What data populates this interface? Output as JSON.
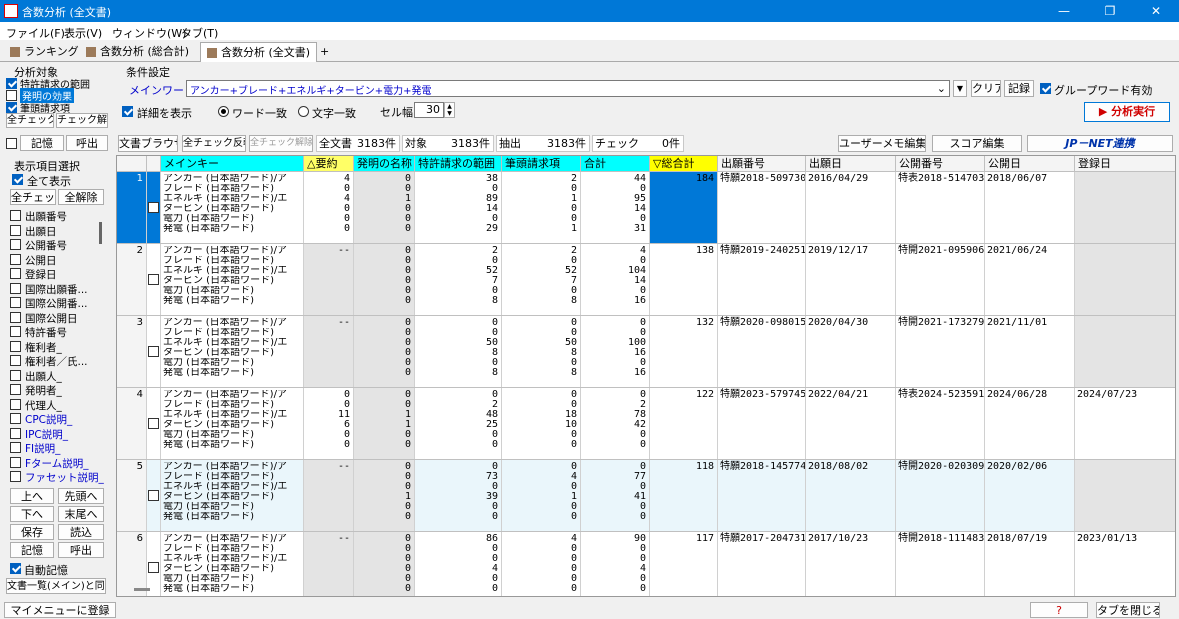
{
  "window": {
    "title": "含数分析 (全文書)",
    "min": "—",
    "max": "❐",
    "close": "✕"
  },
  "menu": [
    "ファイル(F)",
    "表示(V)",
    "ウィンドウ(W)",
    "タブ(T)"
  ],
  "tabs": [
    "ランキング",
    "含数分析 (総合計)",
    "含数分析 (全文書)",
    "+"
  ],
  "left": {
    "group_title": "分析対象",
    "targets": [
      {
        "label": "特許請求の範囲",
        "checked": true
      },
      {
        "label": "発明の効果",
        "checked": false
      },
      {
        "label": "筆頭請求項",
        "checked": true
      }
    ],
    "all_check": "全チェック",
    "check_clear": "チェック解除",
    "memory": "記憶",
    "recall": "呼出",
    "display_title": "表示項目選択",
    "show_all": "全て表示",
    "all_check2": "全チェック",
    "all_clear": "全解除",
    "items": [
      "出願番号",
      "出願日",
      "公開番号",
      "公開日",
      "登録日",
      "国際出願番...",
      "国際公開番...",
      "国際公開日",
      "特許番号",
      "権利者_",
      "権利者／氏...",
      "出願人_",
      "発明者_",
      "代理人_",
      "CPC説明_",
      "IPC説明_",
      "FI説明_",
      "Fターム説明_",
      "ファセット説明_"
    ],
    "up": "上へ",
    "top": "先頭へ",
    "down": "下へ",
    "bottom": "末尾へ",
    "save": "保存",
    "load": "読込",
    "memory2": "記憶",
    "recall2": "呼出",
    "auto_memory": "自動記憶",
    "sync": "文書一覧(メイン)と同期"
  },
  "cond": {
    "title": "条件設定",
    "mainword_label": "メインワード",
    "mainword": "アンカー+ブレード+エネルギ+タービン+電力+発電",
    "clear": "クリア",
    "record": "記録",
    "group_word": "グループワード有効",
    "detail": "詳細を表示",
    "word_match": "ワード一致",
    "char_match": "文字一致",
    "cell_width_label": "セル幅",
    "cell_width": "30",
    "run": "▶ 分析実行"
  },
  "toolbar": {
    "doc_browser": "文書ブラウザ",
    "check_invert": "全チェック反転",
    "check_clear": "全チェック解除",
    "all_docs_label": "全文書",
    "all_docs": "3183件",
    "target_label": "対象",
    "target": "3183件",
    "extract_label": "抽出",
    "extract": "3183件",
    "check_label": "チェック",
    "check": "0件",
    "memo_edit": "ユーザーメモ編集",
    "score_edit": "スコア編集",
    "jpnet": "JP－NET連携"
  },
  "columns": [
    "メインキー",
    "△要約",
    "発明の名称",
    "特許請求の範囲",
    "筆頭請求項",
    "合計",
    "▽総合計",
    "出願番号",
    "出願日",
    "公開番号",
    "公開日",
    "登録日"
  ],
  "keys": [
    "アンカー (日本語ワード)/ア",
    "ブレード (日本語ワード)",
    "エネルギ (日本語ワード)/エ",
    "タービン (日本語ワード)",
    "電力 (日本語ワード)",
    "発電 (日本語ワード)"
  ],
  "rows": [
    {
      "no": "1",
      "youyaku": [
        "4",
        "0",
        "4",
        "0",
        "0",
        "0"
      ],
      "meisho": [
        "0",
        "0",
        "1",
        "0",
        "0",
        "0"
      ],
      "seikyu": [
        "38",
        "0",
        "89",
        "14",
        "0",
        "29"
      ],
      "hitto": [
        "2",
        "0",
        "1",
        "0",
        "0",
        "1"
      ],
      "goukei": [
        "44",
        "0",
        "95",
        "14",
        "0",
        "31"
      ],
      "sougoukei": "184",
      "shutsugan": "特願2018-509730",
      "shutsugan_bi": "2016/04/29",
      "kokai": "特表2018-514703",
      "kokai_bi": "2018/06/07",
      "toroku": ""
    },
    {
      "no": "2",
      "youyaku": [
        "--",
        "",
        "",
        "",
        "",
        ""
      ],
      "meisho": [
        "0",
        "0",
        "0",
        "0",
        "0",
        "0"
      ],
      "seikyu": [
        "2",
        "0",
        "52",
        "7",
        "0",
        "8"
      ],
      "hitto": [
        "2",
        "0",
        "52",
        "7",
        "0",
        "8"
      ],
      "goukei": [
        "4",
        "0",
        "104",
        "14",
        "0",
        "16"
      ],
      "sougoukei": "138",
      "shutsugan": "特願2019-240251",
      "shutsugan_bi": "2019/12/17",
      "kokai": "特開2021-095906",
      "kokai_bi": "2021/06/24",
      "toroku": ""
    },
    {
      "no": "3",
      "youyaku": [
        "--",
        "",
        "",
        "",
        "",
        ""
      ],
      "meisho": [
        "0",
        "0",
        "0",
        "0",
        "0",
        "0"
      ],
      "seikyu": [
        "0",
        "0",
        "50",
        "8",
        "0",
        "8"
      ],
      "hitto": [
        "0",
        "0",
        "50",
        "8",
        "0",
        "8"
      ],
      "goukei": [
        "0",
        "0",
        "100",
        "16",
        "0",
        "16"
      ],
      "sougoukei": "132",
      "shutsugan": "特願2020-098015",
      "shutsugan_bi": "2020/04/30",
      "kokai": "特開2021-173279",
      "kokai_bi": "2021/11/01",
      "toroku": ""
    },
    {
      "no": "4",
      "youyaku": [
        "0",
        "0",
        "11",
        "6",
        "0",
        "0"
      ],
      "meisho": [
        "0",
        "0",
        "1",
        "1",
        "0",
        "0"
      ],
      "seikyu": [
        "0",
        "2",
        "48",
        "25",
        "0",
        "0"
      ],
      "hitto": [
        "0",
        "0",
        "18",
        "10",
        "0",
        "0"
      ],
      "goukei": [
        "0",
        "2",
        "78",
        "42",
        "0",
        "0"
      ],
      "sougoukei": "122",
      "shutsugan": "特願2023-579745",
      "shutsugan_bi": "2022/04/21",
      "kokai": "特表2024-523591",
      "kokai_bi": "2024/06/28",
      "toroku": "2024/07/23"
    },
    {
      "no": "5",
      "youyaku": [
        "--",
        "",
        "",
        "",
        "",
        ""
      ],
      "meisho": [
        "0",
        "0",
        "0",
        "1",
        "0",
        "0"
      ],
      "seikyu": [
        "0",
        "73",
        "0",
        "39",
        "0",
        "0"
      ],
      "hitto": [
        "0",
        "4",
        "0",
        "1",
        "0",
        "0"
      ],
      "goukei": [
        "0",
        "77",
        "0",
        "41",
        "0",
        "0"
      ],
      "sougoukei": "118",
      "shutsugan": "特願2018-145774",
      "shutsugan_bi": "2018/08/02",
      "kokai": "特開2020-020309",
      "kokai_bi": "2020/02/06",
      "toroku": ""
    },
    {
      "no": "6",
      "youyaku": [
        "--",
        "",
        "",
        "",
        "",
        ""
      ],
      "meisho": [
        "0",
        "0",
        "0",
        "0",
        "0",
        "0"
      ],
      "seikyu": [
        "86",
        "0",
        "0",
        "4",
        "0",
        "0"
      ],
      "hitto": [
        "4",
        "0",
        "0",
        "0",
        "0",
        "0"
      ],
      "goukei": [
        "90",
        "0",
        "0",
        "4",
        "0",
        "0"
      ],
      "sougoukei": "117",
      "shutsugan": "特願2017-204731",
      "shutsugan_bi": "2017/10/23",
      "kokai": "特開2018-111483",
      "kokai_bi": "2018/07/19",
      "toroku": "2023/01/13"
    }
  ],
  "status": {
    "register": "マイメニューに登録",
    "help": "?",
    "close_tab": "タブを閉じる"
  }
}
